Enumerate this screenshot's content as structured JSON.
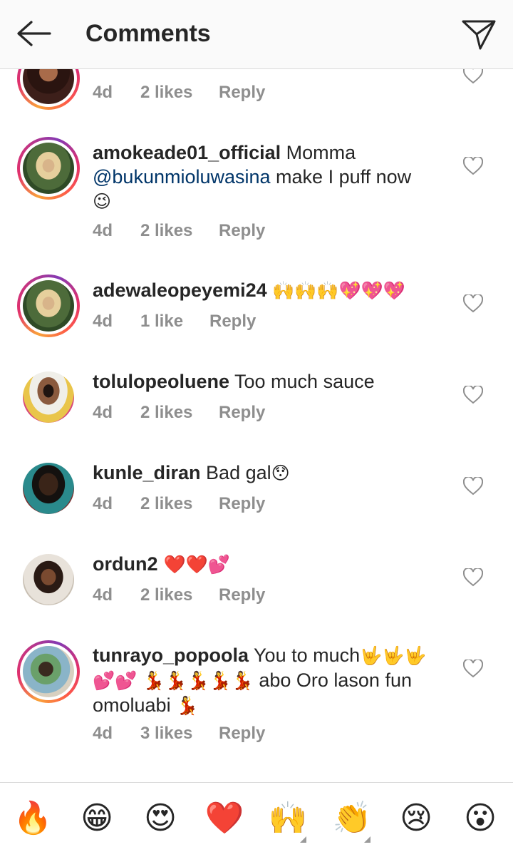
{
  "header": {
    "title": "Comments"
  },
  "comments": [
    {
      "user": "",
      "text": "",
      "time": "4d",
      "likes": "2 likes",
      "reply": "Reply"
    },
    {
      "user": "amokeade01_official",
      "text1": " Momma",
      "mention": "@bukunmioluwasina",
      "text2": " make I puff now",
      "emoji": "😉",
      "time": "4d",
      "likes": "2 likes",
      "reply": "Reply"
    },
    {
      "user": "adewaleopeyemi24",
      "text": "",
      "emoji": "🙌🙌🙌💖💖💖",
      "time": "4d",
      "likes": "1 like",
      "reply": "Reply"
    },
    {
      "user": "tolulopeoluene",
      "text": " Too much sauce",
      "time": "4d",
      "likes": "2 likes",
      "reply": "Reply"
    },
    {
      "user": "kunle_diran",
      "text": " Bad gal",
      "emoji": "😯",
      "time": "4d",
      "likes": "2 likes",
      "reply": "Reply"
    },
    {
      "user": "ordun2",
      "text": "",
      "emoji": " ❤️❤️💕",
      "time": "4d",
      "likes": "2 likes",
      "reply": "Reply"
    },
    {
      "user": "tunrayo_popoola",
      "text1": " You to much",
      "emoji1": "🤟🤟🤟",
      "emoji2": "💕💕 💃💃💃💃💃",
      "text2": " abo Oro lason fun omoluabi ",
      "emoji3": "💃",
      "time": "4d",
      "likes": "3 likes",
      "reply": "Reply"
    }
  ],
  "reactions": [
    "🔥",
    "😁",
    "😍",
    "❤️",
    "🙌",
    "👏",
    "😢",
    "😮"
  ],
  "icons": {
    "back": "back-arrow-icon",
    "share": "paper-plane-icon",
    "like": "heart-outline-icon"
  },
  "colors": {
    "mention": "#003569",
    "meta": "#8e8e8e",
    "text": "#262626"
  }
}
